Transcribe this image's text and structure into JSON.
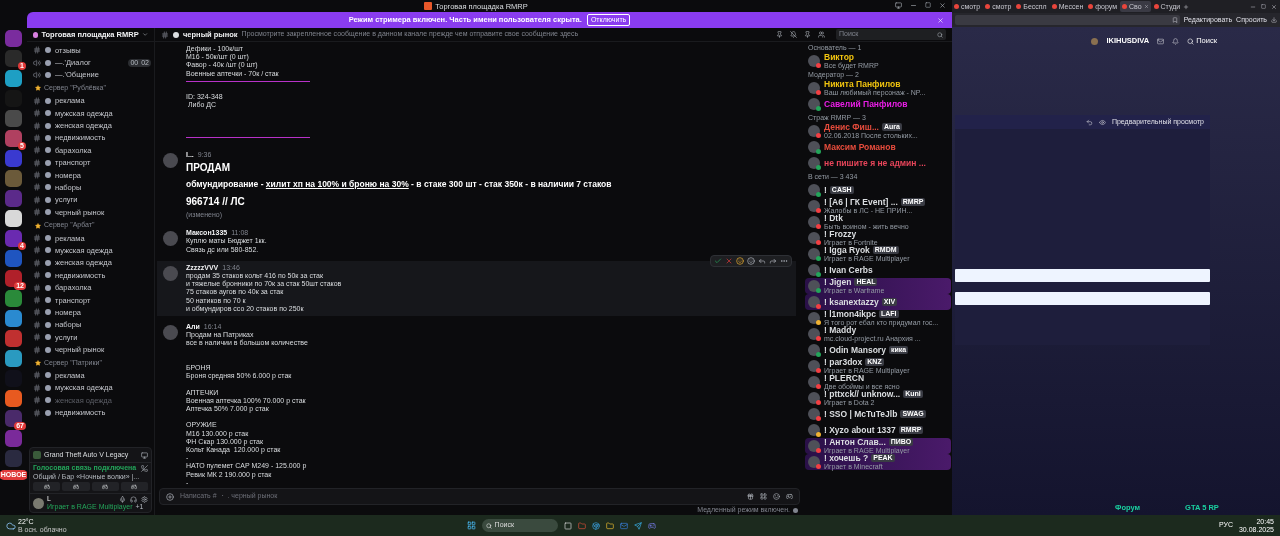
{
  "window": {
    "title": "Торговая площадка RMRP"
  },
  "streamer_banner": {
    "text": "Режим стримера включен. Часть имени пользователя скрыта.",
    "button": "Отключить"
  },
  "servers": [
    {
      "color": "#7a2c9e"
    },
    {
      "color": "#2a2a2a",
      "badge": "1"
    },
    {
      "color": "#1e9fc4"
    },
    {
      "color": "#151515"
    },
    {
      "color": "#4a4a4a"
    },
    {
      "color": "#b04060",
      "badge": "5"
    },
    {
      "color": "#3a3ad0"
    },
    {
      "color": "#6b5a3a"
    },
    {
      "color": "#5b2a8a"
    },
    {
      "color": "#d8d8d8"
    },
    {
      "color": "#6a2ab0",
      "badge": "4"
    },
    {
      "color": "#1f55c0"
    },
    {
      "color": "#b0202a",
      "badge": "12"
    },
    {
      "color": "#2a8a3a"
    },
    {
      "color": "#2a8ad0"
    },
    {
      "color": "#c03030"
    },
    {
      "color": "#2a9ac0"
    },
    {
      "color": "#10101a"
    },
    {
      "color": "#e85a20"
    },
    {
      "color": "#4a2a6a",
      "badge": "67"
    },
    {
      "color": "#7a2a9a"
    },
    {
      "color": "#2a2a40"
    }
  ],
  "new_label": "НОВОЕ",
  "server_header": {
    "name": "Торговая площадка RMRP"
  },
  "channels": [
    {
      "kind": "text",
      "name": "отзывы",
      "muted": false
    },
    {
      "kind": "voice",
      "name": "—.'Диалог",
      "muted": false,
      "limit": [
        "00",
        "02"
      ]
    },
    {
      "kind": "voice",
      "name": "—.'Общение",
      "muted": false
    },
    {
      "kind": "category",
      "name": "Сервер \"Рублёвка\"",
      "children": [
        {
          "kind": "text",
          "name": "реклама",
          "muted": false
        },
        {
          "kind": "text",
          "name": "мужская одежда",
          "muted": false
        },
        {
          "kind": "text",
          "name": "женская одежда",
          "muted": false
        },
        {
          "kind": "text",
          "name": "недвижимость",
          "muted": false
        },
        {
          "kind": "text",
          "name": "барахолка",
          "muted": false
        },
        {
          "kind": "text",
          "name": "транспорт",
          "muted": false
        },
        {
          "kind": "text",
          "name": "номера",
          "muted": false
        },
        {
          "kind": "text",
          "name": "наборы",
          "muted": false
        },
        {
          "kind": "text",
          "name": "услуги",
          "muted": false
        },
        {
          "kind": "text",
          "name": "черный рынок",
          "muted": false
        }
      ]
    },
    {
      "kind": "category",
      "name": "Сервер \"Арбат\"",
      "children": [
        {
          "kind": "text",
          "name": "реклама",
          "muted": false
        },
        {
          "kind": "text",
          "name": "мужская одежда",
          "muted": false
        },
        {
          "kind": "text",
          "name": "женская одежда",
          "muted": false
        },
        {
          "kind": "text",
          "name": "недвижимость",
          "muted": false
        },
        {
          "kind": "text",
          "name": "барахолка",
          "muted": false
        },
        {
          "kind": "text",
          "name": "транспорт",
          "muted": false
        },
        {
          "kind": "text",
          "name": "номера",
          "muted": false
        },
        {
          "kind": "text",
          "name": "наборы",
          "muted": false
        },
        {
          "kind": "text",
          "name": "услуги",
          "muted": false
        },
        {
          "kind": "text",
          "name": "черный рынок",
          "muted": false
        }
      ]
    },
    {
      "kind": "category",
      "name": "Сервер \"Патрики\"",
      "children": [
        {
          "kind": "text",
          "name": "реклама",
          "muted": false
        },
        {
          "kind": "text",
          "name": "мужская одежда",
          "muted": false
        },
        {
          "kind": "text",
          "name": "женская одежда",
          "muted": true
        },
        {
          "kind": "text",
          "name": "недвижимость",
          "muted": false
        }
      ]
    }
  ],
  "activity_panel": {
    "game": "Grand Theft Auto V Legacy"
  },
  "voice_panel": {
    "status": "Голосовая связь подключена",
    "channel": "Общий / Бар «Ночные волки» |..."
  },
  "user_panel": {
    "name": "L",
    "activity": "Играет в RAGE Multiplayer",
    "extra": "+1"
  },
  "chat": {
    "channel": "черный рынок",
    "topic": "Просмотрите закрепленное сообщение в данном канале прежде чем отправите свое сообщение здесь",
    "messages": [
      {
        "highlighted": false,
        "lines": [
          {
            "kind": "text",
            "text": "Дефики - 100к/шт"
          },
          {
            "kind": "text",
            "text": "M16 - 50к/шт (0 шт)"
          },
          {
            "kind": "text",
            "text": "Фавор - 40к /шт (0 шт)"
          },
          {
            "kind": "text",
            "text": "Военные аптечки - 70к / стак"
          },
          {
            "kind": "divider"
          },
          {
            "kind": "blank"
          },
          {
            "kind": "text",
            "text": "ID: 324-348"
          },
          {
            "kind": "text",
            "text": " Либо ДС"
          },
          {
            "kind": "blank"
          },
          {
            "kind": "blank"
          },
          {
            "kind": "blank"
          },
          {
            "kind": "divider"
          }
        ]
      },
      {
        "author": "I...",
        "time": "9:36",
        "highlighted": false,
        "lines": [
          {
            "kind": "heading",
            "text": "ПРОДАМ"
          },
          {
            "kind": "rich",
            "parts": [
              {
                "text": "обмундирование - ",
                "underline": false
              },
              {
                "text": "хилит хп на 100% и броню на 30%",
                "underline": true
              },
              {
                "text": " - в стаке 300 шт - стак 350к - в наличии 7 стаков",
                "underline": false
              }
            ]
          },
          {
            "kind": "heading",
            "text": "966714 // ЛС"
          }
        ],
        "edited": "(изменено)"
      },
      {
        "author": "Максон1335",
        "time": "11:08",
        "highlighted": false,
        "lines": [
          {
            "kind": "text",
            "text": "Куплю маты Бюджет 1кк."
          },
          {
            "kind": "text",
            "text": "Связь дс или 580-852."
          }
        ]
      },
      {
        "author": "ZzzzzVVV",
        "time": "13:46",
        "highlighted": true,
        "lines": [
          {
            "kind": "text",
            "text": "продам 35 стаков кольт 416 по 50к за стак"
          },
          {
            "kind": "text",
            "text": "и тяжелые бронники по 70к за стак 50шт стаков"
          },
          {
            "kind": "text",
            "text": "75 стаков аугов по 40к за стак"
          },
          {
            "kind": "text",
            "text": "50 натиков по 70 к"
          },
          {
            "kind": "text",
            "text": "и обмундиров ссо 20 стаков по 250к"
          }
        ]
      },
      {
        "author": "Али",
        "time": "16:14",
        "highlighted": false,
        "lines": [
          {
            "kind": "text",
            "text": "Продам на Патриках"
          },
          {
            "kind": "text",
            "text": "все в наличии в большом количестве"
          },
          {
            "kind": "blank"
          },
          {
            "kind": "blank"
          },
          {
            "kind": "text",
            "text": "БРОНЯ"
          },
          {
            "kind": "text",
            "text": "Броня средняя 50% 6.000 р стак"
          },
          {
            "kind": "blank"
          },
          {
            "kind": "text",
            "text": "АПТЕЧКИ"
          },
          {
            "kind": "text",
            "text": "Военная аптечка 100% 70.000 р стак"
          },
          {
            "kind": "text",
            "text": "Аптечка 50% 7.000 р стак"
          },
          {
            "kind": "blank"
          },
          {
            "kind": "text",
            "text": "ОРУЖИЕ"
          },
          {
            "kind": "text",
            "text": "M16 130.000 р стак"
          },
          {
            "kind": "text",
            "text": "ФН Скар 130.000 р стак"
          },
          {
            "kind": "text",
            "text": "Кольт Канада  120.000 р стак"
          },
          {
            "kind": "text",
            "text": "-"
          },
          {
            "kind": "text",
            "text": "НАТО пулемет CAP M249 - 125.000 р"
          },
          {
            "kind": "text",
            "text": "Ревик МК 2 190.000 р стак"
          },
          {
            "kind": "text",
            "text": "-"
          }
        ]
      }
    ],
    "input": {
      "placeholder": "Написать # ・ . черный рынок"
    },
    "slow_mode": "Медленный режим включен."
  },
  "member_search": {
    "placeholder": "Поиск"
  },
  "member_groups": [
    {
      "title": "Основатель — 1",
      "members": [
        {
          "name": "Виктор",
          "color": "#f1c40f",
          "status": {
            "color": "#f23f43"
          },
          "activity": "Все будет RMRP",
          "boosted": false
        }
      ]
    },
    {
      "title": "Модератор — 2",
      "members": [
        {
          "name": "Никита Панфилов",
          "color": "#f1c40f",
          "status": {
            "color": "#f23f43"
          },
          "activity": "Ваш любимый персонаж - NP...",
          "boosted": false
        },
        {
          "name": "Савелий Панфилов",
          "color": "#e91ee6",
          "status": {
            "color": "#23a55a"
          },
          "boosted": false
        }
      ]
    },
    {
      "title": "Страж RMRP — 3",
      "members": [
        {
          "name": "Денис Фиш...",
          "color": "#e74c3c",
          "status": {
            "color": "#f23f43"
          },
          "activity": "02.06.2018 После стольких...",
          "tag": "Aura",
          "boosted": false
        },
        {
          "name": "Максим Романов",
          "color": "#e74c3c",
          "status": {
            "color": "#23a55a"
          },
          "boosted": false
        },
        {
          "name": "не пишите я не админ ...",
          "color": "#e8455a",
          "status": {
            "color": "#23a55a"
          },
          "boosted": false
        }
      ]
    },
    {
      "title": "В сети — 3 434",
      "members": [
        {
          "name": "!",
          "color": "#dbdee1",
          "status": {
            "color": "#23a55a"
          },
          "tag": "CASH",
          "boosted": false
        },
        {
          "name": "! [A6 | ГК Event] ...",
          "color": "#dbdee1",
          "status": {
            "color": "#f23f43"
          },
          "activity": "Жалобы в ЛС - НЕ ПРИН...",
          "tag": "RMRP",
          "boosted": false
        },
        {
          "name": "! Dtk",
          "color": "#dbdee1",
          "status": {
            "color": "#f23f43"
          },
          "activity": "Быть воином - жить вечно",
          "boosted": false
        },
        {
          "name": "! Frozzy",
          "color": "#dbdee1",
          "status": {
            "color": "#f23f43"
          },
          "activity": "Играет в Fortnite",
          "boosted": false
        },
        {
          "name": "! Igga Ryok",
          "color": "#dbdee1",
          "status": {
            "color": "#23a55a"
          },
          "activity": "Играет в RAGE Multiplayer",
          "tag": "RMDM",
          "boosted": false
        },
        {
          "name": "! Ivan Cerbs",
          "color": "#dbdee1",
          "status": {
            "color": "#23a55a"
          },
          "boosted": false
        },
        {
          "name": "! Jigen",
          "color": "#dbdee1",
          "status": {
            "color": "#23a55a"
          },
          "activity": "Играет в Warframe",
          "tag": "HEAL",
          "boosted": true
        },
        {
          "name": "! ksanextazzy",
          "color": "#dbdee1",
          "status": {
            "color": "#f23f43"
          },
          "tag": "XIV",
          "boosted": true
        },
        {
          "name": "! l1mon4ikpc",
          "color": "#dbdee1",
          "status": {
            "color": "#f0b232"
          },
          "activity": "Я того рот ебал кто придумал гос...",
          "tag": "LAFI",
          "boosted": false
        },
        {
          "name": "! Maddy",
          "color": "#dbdee1",
          "status": {
            "color": "#f23f43"
          },
          "activity": "mc.cloud-project.ru Анархия ...",
          "boosted": false
        },
        {
          "name": "! Odin Mansory",
          "color": "#dbdee1",
          "status": {
            "color": "#23a55a"
          },
          "tag": "кика",
          "boosted": false
        },
        {
          "name": "! par3dox",
          "color": "#dbdee1",
          "status": {
            "color": "#f23f43"
          },
          "activity": "Играет в RAGE Multiplayer",
          "tag": "KNZ",
          "boosted": false
        },
        {
          "name": "! PLERCN",
          "color": "#dbdee1",
          "status": {
            "color": "#f23f43"
          },
          "activity": "Две обоймы и все ясно",
          "boosted": false
        },
        {
          "name": "! pttxck// unknow...",
          "color": "#dbdee1",
          "status": {
            "color": "#f23f43"
          },
          "activity": "Играет в Dota 2",
          "tag": "Kuni",
          "boosted": false
        },
        {
          "name": "! SSO | McTuTeJlb",
          "color": "#dbdee1",
          "status": {
            "color": "#f23f43"
          },
          "tag": "SWAG",
          "boosted": false
        },
        {
          "name": "! Xyzo about 1337",
          "color": "#dbdee1",
          "status": {
            "color": "#f0b232"
          },
          "tag": "RMRP",
          "boosted": false
        },
        {
          "name": "! Антон Слав...",
          "color": "#dbdee1",
          "status": {
            "color": "#f23f43"
          },
          "activity": "Играет в RAGE Multiplayer",
          "tag": "ПИВО",
          "boosted": true
        },
        {
          "name": "! хочешь ?",
          "color": "#dbdee1",
          "status": {
            "color": "#f23f43"
          },
          "activity": "Играет в Minecraft",
          "tag": "PEAK",
          "boosted": true
        }
      ]
    }
  ],
  "browser": {
    "tabs": [
      {
        "label": "смотр",
        "selected": false
      },
      {
        "label": "смотр",
        "selected": false
      },
      {
        "label": "Бесспл",
        "selected": false
      },
      {
        "label": "Мессен",
        "selected": false
      },
      {
        "label": "форум",
        "selected": false
      },
      {
        "label": "Сво",
        "selected": true
      },
      {
        "label": "Студи",
        "selected": false
      }
    ],
    "toolbar": [
      "Редактировать",
      "Спросить"
    ],
    "page": {
      "user": "IKIHUSDIVA",
      "search": "Поиск",
      "preview": "Предварительный просмотр",
      "footer": [
        "Форум",
        "GTA 5 RP"
      ]
    }
  },
  "taskbar": {
    "temp": "22°C",
    "weather": "В осн. облачно",
    "search": "Поиск",
    "lang": "РУС",
    "time": "20:45",
    "date": "30.08.2025"
  }
}
